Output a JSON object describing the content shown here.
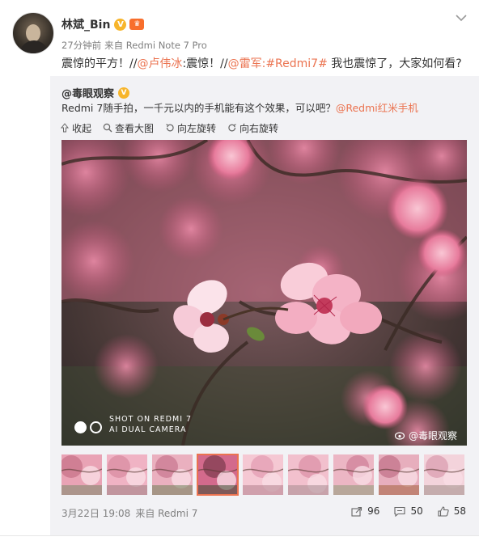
{
  "user": {
    "name": "林斌_Bin",
    "verified_badge": "V",
    "time": "27分钟前",
    "source": "来自 Redmi Note 7 Pro"
  },
  "post": {
    "text_plain": "震惊的平方！//",
    "mention1": "@卢伟冰",
    "text_mid1": ":震惊！//",
    "mention2": "@雷军",
    "text_mid2": ":",
    "hashtag": "#Redmi7#",
    "text_end": " 我也震惊了，大家如何看?"
  },
  "repost": {
    "author": "@毒眼观察",
    "text": "Redmi 7随手拍，一千元以内的手机能有这个效果，可以吧？",
    "mention": "@Redmi红米手机",
    "tools": {
      "collapse": "收起",
      "view_large": "查看大图",
      "rotate_left": "向左旋转",
      "rotate_right": "向右旋转"
    },
    "watermark": {
      "line1": "SHOT ON REDMI 7",
      "line2": "AI DUAL CAMERA",
      "weibo": "@毒眼观察"
    },
    "thumbnail_count": 9,
    "active_thumbnail": 4,
    "date": "3月22日 19:08",
    "source": "来自 Redmi 7",
    "repost_count": "96",
    "comment_count": "50",
    "like_count": "58"
  },
  "colors": {
    "link": "#eb7350",
    "repost_bg": "#f2f2f5",
    "meta_text": "#808080"
  }
}
